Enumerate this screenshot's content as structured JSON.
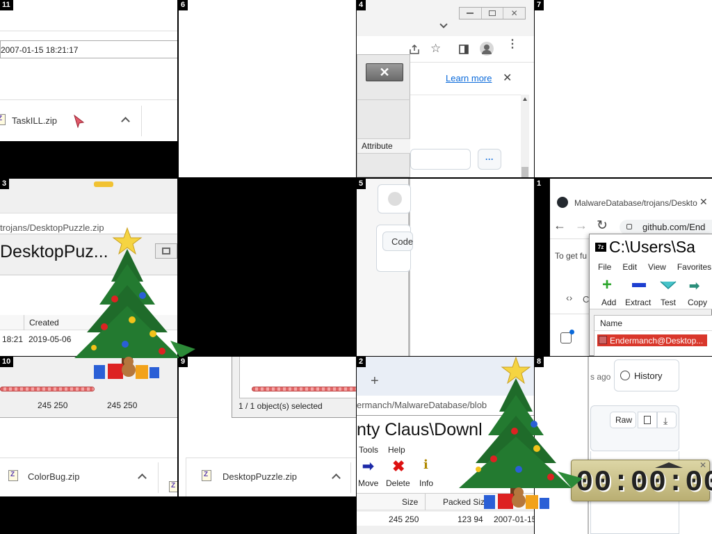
{
  "tiles": {
    "t11": {
      "num": "11",
      "date": "2007-01-15 18:21:17",
      "download": "TaskILL.zip"
    },
    "t6": {
      "num": "6"
    },
    "t4": {
      "num": "4",
      "learn_more": "Learn more",
      "column_attribute": "Attribute",
      "more_glyph": "···"
    },
    "t7": {
      "num": "7"
    },
    "t3": {
      "num": "3",
      "path": "trojans/DesktopPuzzle.zip",
      "title": "DesktopPuz...",
      "col_created": "Created",
      "row_time": "18:21",
      "row_created": "2019-05-06"
    },
    "t5": {
      "num": "5",
      "code_btn": "Code"
    },
    "t1": {
      "num": "1",
      "tab_title": "MalwareDatabase/trojans/Deskto",
      "url": "github.com/End",
      "banner": "To get fu",
      "code_tab": "C",
      "sz_title": "C:\\Users\\Sa",
      "menu": [
        "File",
        "Edit",
        "View",
        "Favorites"
      ],
      "tools": [
        "Add",
        "Extract",
        "Test",
        "Copy"
      ],
      "col_name": "Name",
      "file_row": "Endermanch@Desktop..."
    },
    "t10": {
      "num": "10",
      "size1": "245 250",
      "size2": "245 250",
      "download": "ColorBug.zip"
    },
    "t9": {
      "num": "9",
      "status": "1 / 1 object(s) selected",
      "download": "DesktopPuzzle.zip"
    },
    "t2": {
      "num": "2",
      "plus": "+",
      "url_frag": "ermanch/MalwareDatabase/blob",
      "title_frag": "nty Claus\\Downl",
      "menu": [
        "Tools",
        "Help"
      ],
      "tools": [
        "Move",
        "Delete",
        "Info"
      ],
      "col_size": "Size",
      "col_packed": "Packed Size",
      "row_size": "245 250",
      "row_packed": "123 94",
      "row_date": "2007-01-15"
    },
    "t8": {
      "num": "8",
      "ago": "s ago",
      "history": "History",
      "raw": "Raw",
      "timer": "00:00:00"
    }
  },
  "colors": {
    "accent_blue": "#0969da",
    "selection_red": "#d9372b",
    "tree_green": "#1f6b2a",
    "timer_bg": "#c9c08a"
  }
}
